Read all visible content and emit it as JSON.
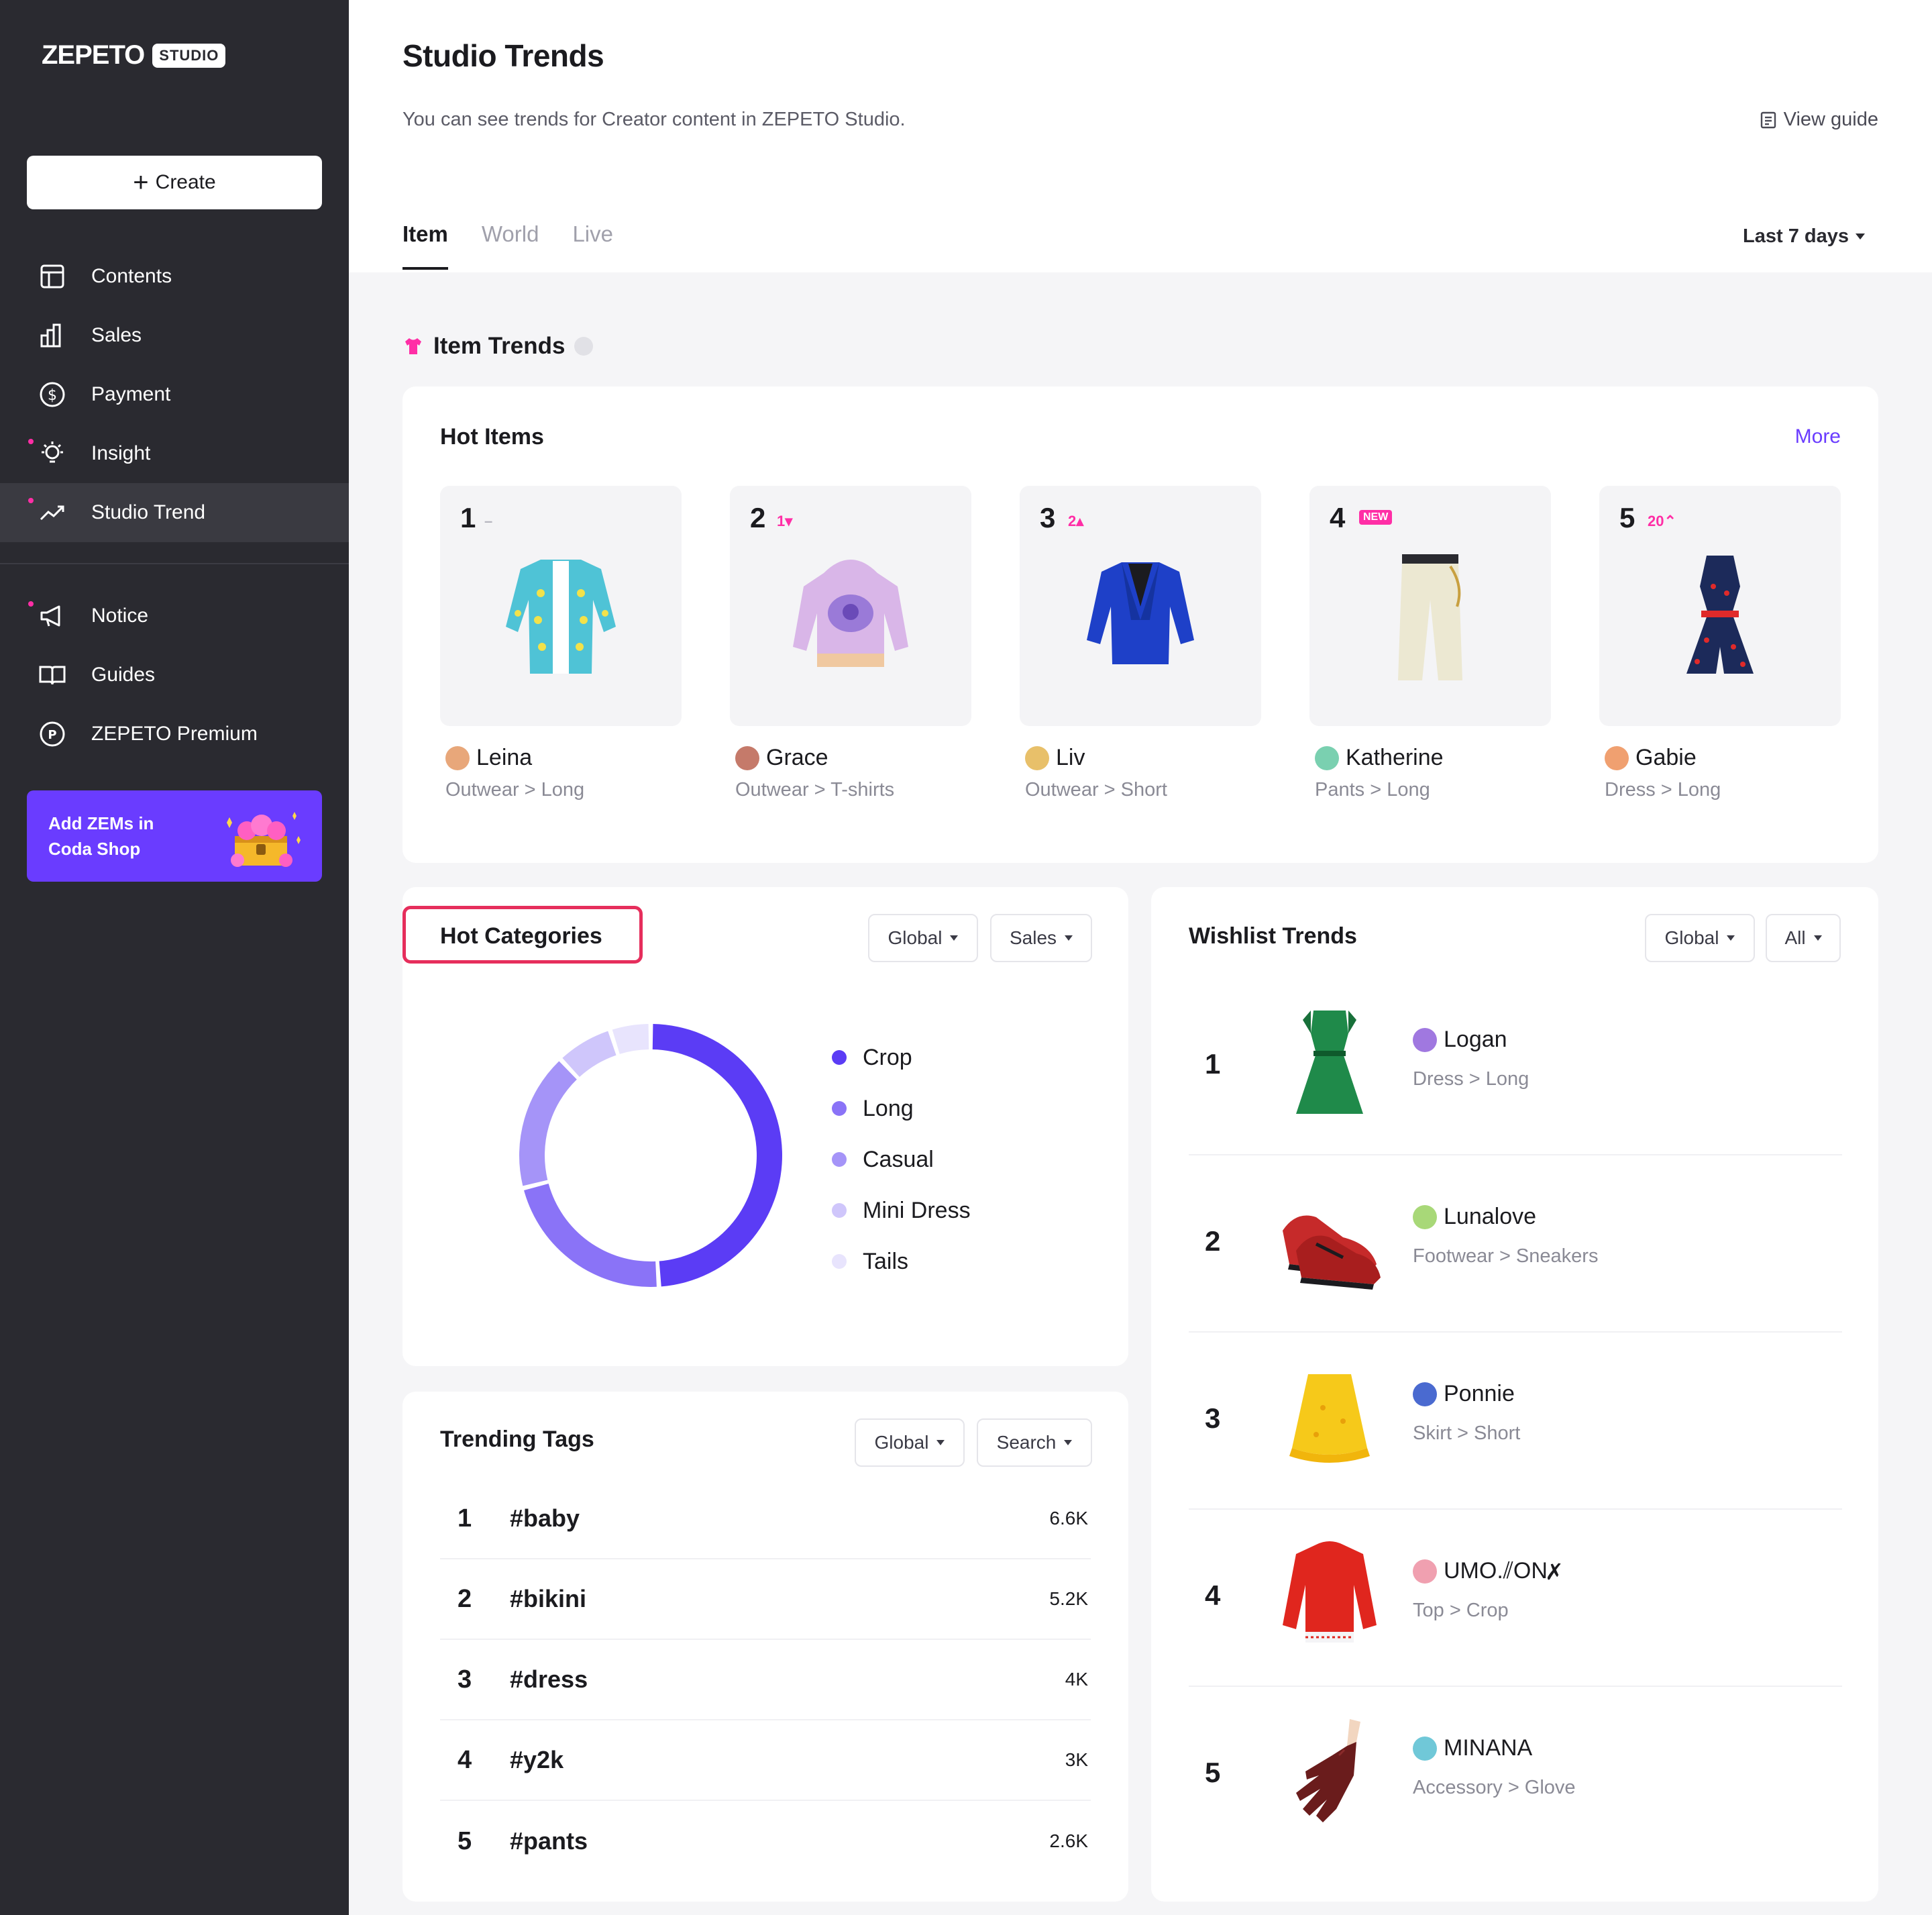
{
  "brand": {
    "wordmark": "ZEPETO",
    "badge": "STUDIO"
  },
  "sidebar": {
    "create_label": "Create",
    "items": [
      {
        "label": "Contents",
        "icon": "layout-icon",
        "active": false,
        "dot": false
      },
      {
        "label": "Sales",
        "icon": "bar-chart-icon",
        "active": false,
        "dot": false
      },
      {
        "label": "Payment",
        "icon": "dollar-circle-icon",
        "active": false,
        "dot": false
      },
      {
        "label": "Insight",
        "icon": "lightbulb-icon",
        "active": false,
        "dot": true
      },
      {
        "label": "Studio Trend",
        "icon": "trend-up-icon",
        "active": true,
        "dot": true
      },
      {
        "label": "Notice",
        "icon": "megaphone-icon",
        "active": false,
        "dot": true
      },
      {
        "label": "Guides",
        "icon": "book-icon",
        "active": false,
        "dot": false
      },
      {
        "label": "ZEPETO Premium",
        "icon": "premium-p-icon",
        "active": false,
        "dot": false
      }
    ],
    "promo": {
      "line1": "Add ZEMs in",
      "line2": "Coda Shop"
    }
  },
  "header": {
    "title": "Studio Trends",
    "subtitle": "You can see trends for Creator content in ZEPETO Studio.",
    "view_guide": "View guide",
    "tabs": [
      {
        "label": "Item",
        "active": true
      },
      {
        "label": "World",
        "active": false
      },
      {
        "label": "Live",
        "active": false
      }
    ],
    "period": "Last 7 days"
  },
  "item_trends": {
    "title": "Item Trends",
    "hot_items": {
      "title": "Hot Items",
      "more": "More",
      "items": [
        {
          "rank": "1",
          "change": "–",
          "change_type": "flat",
          "creator": "Leina",
          "category": "Outwear > Long",
          "art": "shirt-jacket",
          "color": "#4fc3d6",
          "avatar": "#e8a77a"
        },
        {
          "rank": "2",
          "change": "1▾",
          "change_type": "down",
          "creator": "Grace",
          "category": "Outwear > T-shirts",
          "art": "hoodie",
          "color": "#d9b6e8",
          "avatar": "#c57a6a"
        },
        {
          "rank": "3",
          "change": "2▴",
          "change_type": "up",
          "creator": "Liv",
          "category": "Outwear > Short",
          "art": "blazer",
          "color": "#1e40c8",
          "avatar": "#e8c06a"
        },
        {
          "rank": "4",
          "change": "NEW",
          "change_type": "new",
          "creator": "Katherine",
          "category": "Pants > Long",
          "art": "pants",
          "color": "#ece8d2",
          "avatar": "#7ad0b0"
        },
        {
          "rank": "5",
          "change": "20⌃",
          "change_type": "up",
          "creator": "Gabie",
          "category": "Dress > Long",
          "art": "romper",
          "color": "#1c2a5a",
          "avatar": "#f0a070"
        }
      ]
    }
  },
  "hot_categories": {
    "title": "Hot Categories",
    "filters": [
      "Global",
      "Sales"
    ],
    "legend": [
      {
        "label": "Crop",
        "color": "#5b3cf5"
      },
      {
        "label": "Long",
        "color": "#8a73f7"
      },
      {
        "label": "Casual",
        "color": "#a594f8"
      },
      {
        "label": "Mini Dress",
        "color": "#cfc6fb"
      },
      {
        "label": "Tails",
        "color": "#e8e4fd"
      }
    ]
  },
  "chart_data": {
    "type": "pie",
    "categories": [
      "Crop",
      "Long",
      "Casual",
      "Mini Dress",
      "Tails"
    ],
    "values": [
      49,
      22,
      17,
      7,
      5
    ],
    "title": "",
    "donut": true
  },
  "trending_tags": {
    "title": "Trending Tags",
    "filters": [
      "Global",
      "Search"
    ],
    "rows": [
      {
        "rank": "1",
        "tag": "#baby",
        "count": "6.6K"
      },
      {
        "rank": "2",
        "tag": "#bikini",
        "count": "5.2K"
      },
      {
        "rank": "3",
        "tag": "#dress",
        "count": "4K"
      },
      {
        "rank": "4",
        "tag": "#y2k",
        "count": "3K"
      },
      {
        "rank": "5",
        "tag": "#pants",
        "count": "2.6K"
      }
    ]
  },
  "wishlist_trends": {
    "title": "Wishlist Trends",
    "filters": [
      "Global",
      "All"
    ],
    "rows": [
      {
        "rank": "1",
        "creator": "Logan",
        "category": "Dress > Long",
        "art": "green-dress",
        "color": "#1f8a4a",
        "avatar": "#a078e0"
      },
      {
        "rank": "2",
        "creator": "Lunalove",
        "category": "Footwear > Sneakers",
        "art": "sneakers",
        "color": "#c62a2a",
        "avatar": "#a8d878"
      },
      {
        "rank": "3",
        "creator": "Ponnie",
        "category": "Skirt > Short",
        "art": "skirt",
        "color": "#f6c91a",
        "avatar": "#4a6ad0"
      },
      {
        "rank": "4",
        "creator": "UMO.⫽ON✗",
        "category": "Top > Crop",
        "art": "sweater",
        "color": "#e0261e",
        "avatar": "#f0a0b0"
      },
      {
        "rank": "5",
        "creator": "MINANA",
        "category": "Accessory > Glove",
        "art": "glove",
        "color": "#6a1c1c",
        "avatar": "#70c8d8"
      }
    ]
  }
}
